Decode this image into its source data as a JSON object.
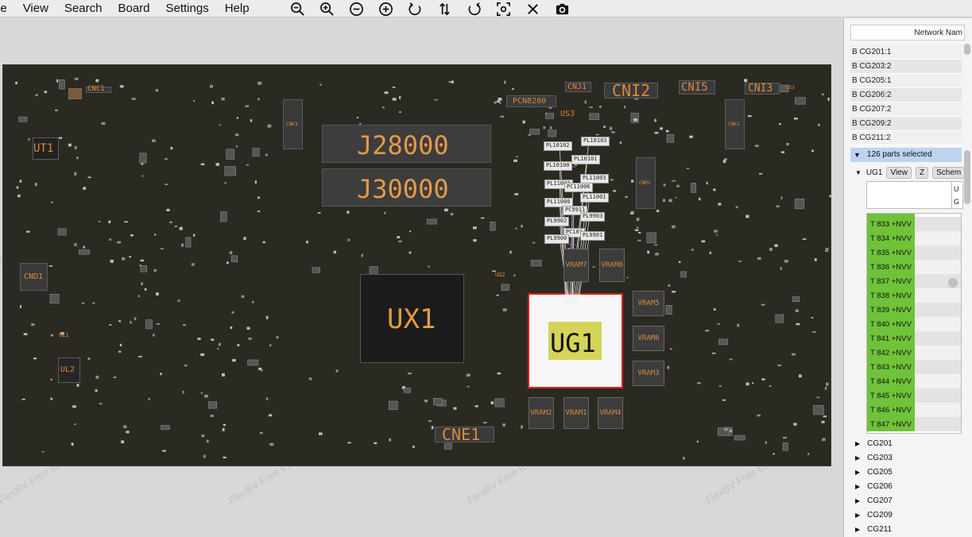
{
  "menu": [
    "le",
    "View",
    "Search",
    "Board",
    "Settings",
    "Help"
  ],
  "toolbar_icons": [
    "zoom-out-icon",
    "zoom-in-icon",
    "zoom-minus-icon",
    "zoom-plus-icon",
    "rotate-left-icon",
    "flip-icon",
    "rotate-right-icon",
    "fit-icon",
    "close-icon",
    "camera-icon"
  ],
  "board": {
    "labels": {
      "j28000": "J28000",
      "j30000": "J30000",
      "ux1": "UX1",
      "ug1": "UG1",
      "cne1": "CNE1",
      "cni2": "CNI2",
      "cni5": "CNI5",
      "cni3": "CNI3",
      "cnj1": "CNJ1",
      "pcn8200": "PCN8200",
      "us3": "US3",
      "cnc1": "CNC1",
      "ut1": "UT1",
      "cnd1": "CND1",
      "ul2": "UL2",
      "ul1": "UL1",
      "ug2": "UG2",
      "cnk3": "CNK3",
      "cnk1": "CNK1",
      "cnm1": "CNM1",
      "us3b": "US3",
      "vram1": "VRAM1",
      "vram2": "VRAM2",
      "vram3": "VRAM3",
      "vram4": "VRAM4",
      "vram5": "VRAM5",
      "vram6": "VRAM6",
      "vram7": "VRAM7",
      "vram8": "VRAM8"
    },
    "pin_tags": [
      "PL10102",
      "PL10103",
      "PL10101",
      "PL10100",
      "PL11003",
      "PL11002",
      "PC11006",
      "PL11001",
      "PL11000",
      "PC9911",
      "PL9902",
      "PL9903",
      "PC101",
      "PL9900",
      "PL9901"
    ],
    "watermark": "FlexBV Free Edition"
  },
  "panel": {
    "header": "Network Nam",
    "nets": [
      "B CG201:1",
      "B CG203:2",
      "B CG205:1",
      "B CG206:2",
      "B CG207:2",
      "B CG209:2",
      "B CG211:2"
    ],
    "selected": "126 parts selected",
    "ug1_label": "UG1",
    "view_btn": "View",
    "z_btn": "Z",
    "schem_btn": "Schem",
    "col_u": "U",
    "col_g": "G",
    "pins": [
      "T  833  +NVV",
      "T  834  +NVV",
      "T  835  +NVV",
      "T  836  +NVV",
      "T  837  +NVV",
      "T  838  +NVV",
      "T  839  +NVV",
      "T  840  +NVV",
      "T  841  +NVV",
      "T  842  +NVV",
      "T  843  +NVV",
      "T  844  +NVV",
      "T  845  +NVV",
      "T  846  +NVV",
      "T  847  +NVV"
    ],
    "tree": [
      "CG201",
      "CG203",
      "CG205",
      "CG206",
      "CG207",
      "CG209",
      "CG211"
    ]
  },
  "colors": {
    "board_bg": "#2b2a22",
    "label": "#d98b3a",
    "highlight": "#d4d45a",
    "selection": "#e0201e",
    "pin_green": "#6fc23a"
  }
}
